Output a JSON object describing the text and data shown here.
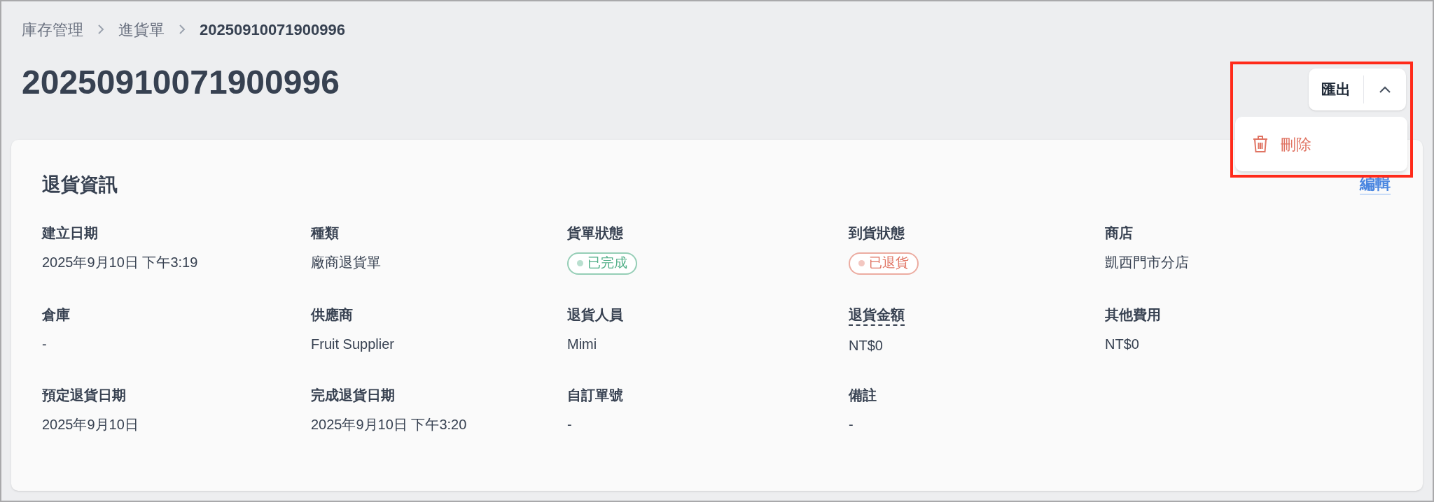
{
  "breadcrumb": [
    {
      "label": "庫存管理",
      "current": false
    },
    {
      "label": "進貨單",
      "current": false
    },
    {
      "label": "20250910071900996",
      "current": true
    }
  ],
  "title": "20250910071900996",
  "actions": {
    "button": "匯出",
    "expanded": true,
    "menu": [
      {
        "label": "刪除",
        "kind": "danger"
      }
    ]
  },
  "section": {
    "title": "退貨資訊",
    "edit_link": "編輯",
    "fields": [
      {
        "label": "建立日期",
        "kind": "text",
        "value": "2025年9月10日 下午3:19"
      },
      {
        "label": "種類",
        "kind": "text",
        "value": "廠商退貨單"
      },
      {
        "label": "貨單狀態",
        "kind": "badge",
        "value": "已完成",
        "color": "#4fae86"
      },
      {
        "label": "到貨狀態",
        "kind": "badge",
        "value": "已退貨",
        "color": "#e07463"
      },
      {
        "label": "商店",
        "kind": "text",
        "value": "凱西門市分店"
      },
      {
        "label": "倉庫",
        "kind": "text",
        "value": "-"
      },
      {
        "label": "供應商",
        "kind": "text",
        "value": "Fruit Supplier"
      },
      {
        "label": "退貨人員",
        "kind": "text",
        "value": "Mimi"
      },
      {
        "label": "退貨金額",
        "kind": "text",
        "value": "NT$0",
        "tooltip": true
      },
      {
        "label": "其他費用",
        "kind": "text",
        "value": "NT$0"
      },
      {
        "label": "預定退貨日期",
        "kind": "text",
        "value": "2025年9月10日"
      },
      {
        "label": "完成退貨日期",
        "kind": "text",
        "value": "2025年9月10日 下午3:20"
      },
      {
        "label": "自訂單號",
        "kind": "text",
        "value": "-"
      },
      {
        "label": "備註",
        "kind": "text",
        "value": "-"
      }
    ]
  }
}
